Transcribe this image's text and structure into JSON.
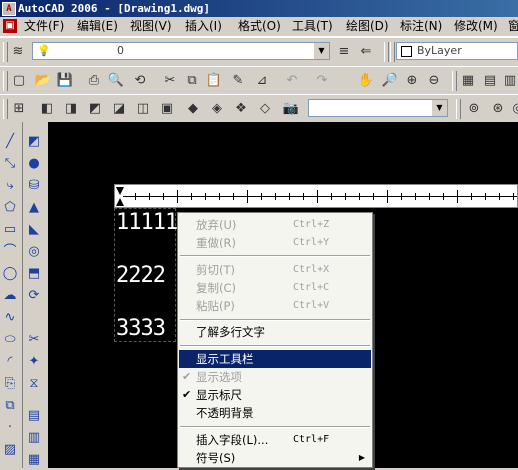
{
  "window": {
    "title": "AutoCAD 2006 - [Drawing1.dwg]"
  },
  "menubar": {
    "items": [
      {
        "label": "文件(F)"
      },
      {
        "label": "编辑(E)"
      },
      {
        "label": "视图(V)"
      },
      {
        "label": "插入(I)"
      },
      {
        "label": "格式(O)"
      },
      {
        "label": "工具(T)"
      },
      {
        "label": "绘图(D)"
      },
      {
        "label": "标注(N)"
      },
      {
        "label": "修改(M)"
      },
      {
        "label": "窗"
      }
    ]
  },
  "layers_toolbar": {
    "current_layer": "0",
    "color_control": "ByLayer"
  },
  "styles_toolbar": {
    "style_combo_value": ""
  },
  "mtext": {
    "lines": [
      "11111",
      "2222",
      "3333"
    ]
  },
  "context_menu": {
    "items": [
      {
        "label": "放弃(U)",
        "shortcut": "Ctrl+Z",
        "state": "disabled"
      },
      {
        "label": "重做(R)",
        "shortcut": "Ctrl+Y",
        "state": "disabled"
      },
      {
        "label": "剪切(T)",
        "shortcut": "Ctrl+X",
        "state": "disabled"
      },
      {
        "label": "复制(C)",
        "shortcut": "Ctrl+C",
        "state": "disabled"
      },
      {
        "label": "粘贴(P)",
        "shortcut": "Ctrl+V",
        "state": "disabled"
      },
      {
        "label": "了解多行文字",
        "shortcut": "",
        "state": "enabled"
      },
      {
        "label": "显示工具栏",
        "shortcut": "",
        "state": "highlighted"
      },
      {
        "label": "显示选项",
        "shortcut": "",
        "state": "disabled",
        "checked": true
      },
      {
        "label": "显示标尺",
        "shortcut": "",
        "state": "enabled",
        "checked": true
      },
      {
        "label": "不透明背景",
        "shortcut": "",
        "state": "enabled"
      },
      {
        "label": "插入字段(L)...",
        "shortcut": "Ctrl+F",
        "state": "enabled"
      },
      {
        "label": "符号(S)",
        "shortcut": "",
        "state": "enabled",
        "submenu": true
      }
    ]
  },
  "icons": {
    "check": "✔",
    "submenu_arrow": "▶",
    "combo_arrow": "▼"
  },
  "colors": {
    "title_bar": "#0a246a",
    "menu_highlight": "#0a246a",
    "canvas": "#000000",
    "disabled_text": "#a0a0a0"
  }
}
